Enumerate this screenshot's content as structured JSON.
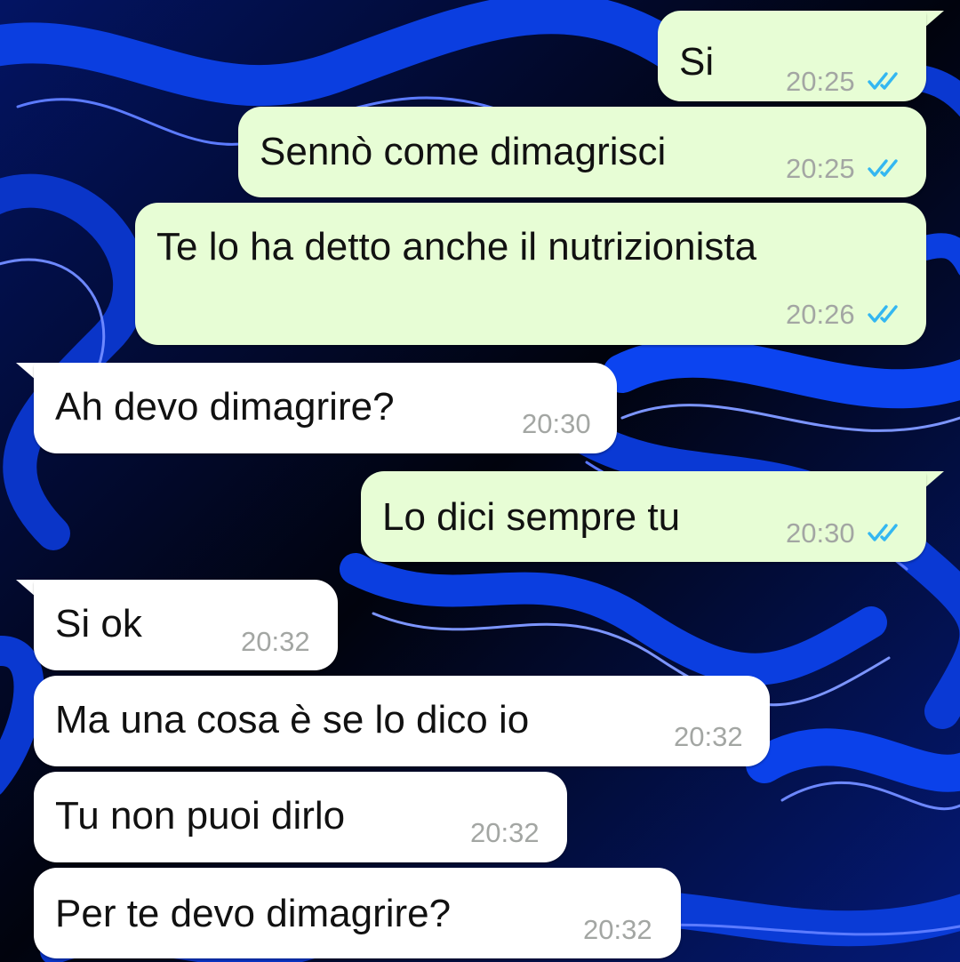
{
  "chat": {
    "messages": [
      {
        "direction": "outgoing",
        "text": "Si",
        "time": "20:25",
        "status": "read",
        "status_icon": "double-check-icon",
        "tick_color": "#34b7f1"
      },
      {
        "direction": "outgoing",
        "text": "Sennò come dimagrisci",
        "time": "20:25",
        "status": "read",
        "status_icon": "double-check-icon",
        "tick_color": "#34b7f1"
      },
      {
        "direction": "outgoing",
        "text": "Te lo ha detto anche il nutrizionista",
        "time": "20:26",
        "status": "read",
        "status_icon": "double-check-icon",
        "tick_color": "#34b7f1"
      },
      {
        "direction": "incoming",
        "text": "Ah devo dimagrire?",
        "time": "20:30"
      },
      {
        "direction": "outgoing",
        "text": "Lo dici sempre tu",
        "time": "20:30",
        "status": "read",
        "status_icon": "double-check-icon",
        "tick_color": "#34b7f1"
      },
      {
        "direction": "incoming",
        "text": "Si ok",
        "time": "20:32"
      },
      {
        "direction": "incoming",
        "text": "Ma una cosa è se lo dico io",
        "time": "20:32"
      },
      {
        "direction": "incoming",
        "text": "Tu non puoi dirlo",
        "time": "20:32"
      },
      {
        "direction": "incoming",
        "text": "Per te devo dimagrire?",
        "time": "20:32"
      }
    ]
  },
  "colors": {
    "outgoing_bubble": "#e7fdd5",
    "incoming_bubble": "#ffffff",
    "timestamp": "#a3a6a3",
    "read_ticks": "#34b7f1",
    "wallpaper_dark": "#020512",
    "wallpaper_blue": "#0a3bd6"
  },
  "wallpaper": {
    "style": "dark blue liquid swirl"
  }
}
